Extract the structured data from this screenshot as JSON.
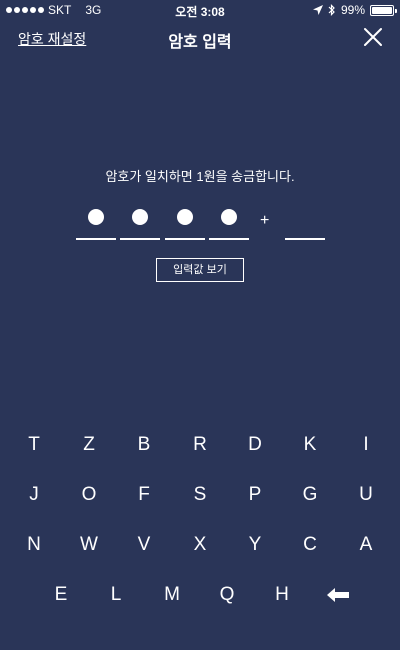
{
  "status_bar": {
    "carrier": "SKT",
    "network": "3G",
    "time": "오전 3:08",
    "battery": "99%",
    "battery_level": 0.99
  },
  "nav": {
    "reset_label": "암호 재설정",
    "title": "암호 입력"
  },
  "instruction": "암호가 일치하면 1원을 송금합니다.",
  "pin": {
    "filled_count": 4,
    "plus": "+"
  },
  "show_input_label": "입력값 보기",
  "keypad": {
    "rows": [
      [
        "T",
        "Z",
        "B",
        "R",
        "D",
        "K",
        "I"
      ],
      [
        "J",
        "O",
        "F",
        "S",
        "P",
        "G",
        "U"
      ],
      [
        "N",
        "W",
        "V",
        "X",
        "Y",
        "C",
        "A"
      ],
      [
        "E",
        "L",
        "M",
        "Q",
        "H"
      ]
    ]
  },
  "colors": {
    "background": "#2a3558",
    "foreground": "#ffffff"
  }
}
